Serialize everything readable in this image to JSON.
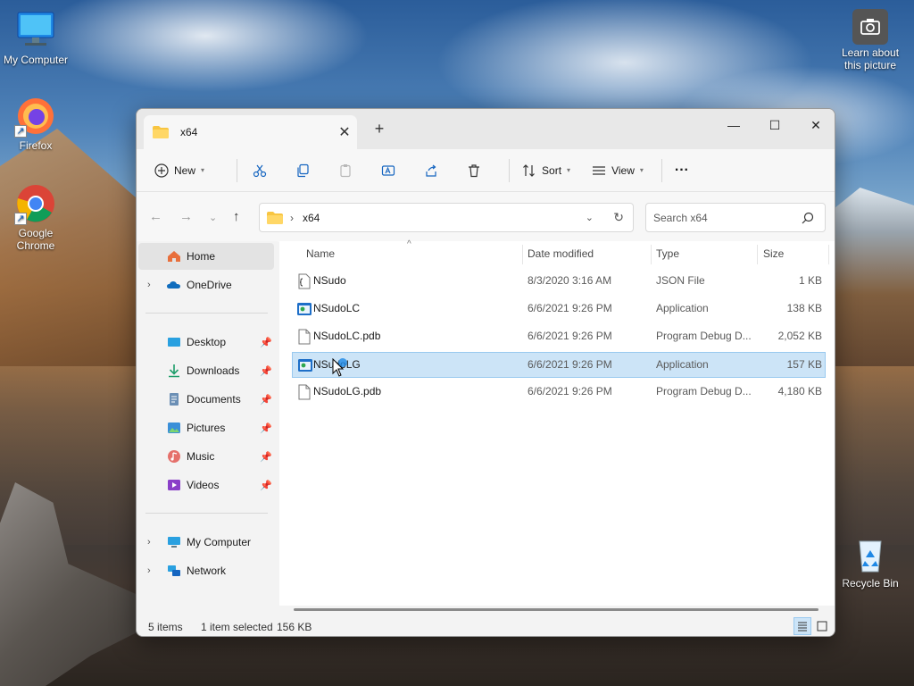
{
  "desktop": {
    "icons": [
      {
        "label": "My Computer"
      },
      {
        "label": "Firefox"
      },
      {
        "label": "Google Chrome"
      },
      {
        "label": "Learn about this picture"
      },
      {
        "label": "Recycle Bin"
      }
    ]
  },
  "window": {
    "tab_title": "x64",
    "tab_close": "✕",
    "new_tab": "+",
    "min": "—",
    "max": "☐",
    "close": "✕"
  },
  "toolbar": {
    "new_label": "New",
    "sort_label": "Sort",
    "view_label": "View",
    "more_label": "···"
  },
  "address": {
    "path_sep": "›",
    "path": "x64",
    "search_placeholder": "Search x64"
  },
  "nav": {
    "home": "Home",
    "onedrive": "OneDrive",
    "quick": [
      {
        "label": "Desktop"
      },
      {
        "label": "Downloads"
      },
      {
        "label": "Documents"
      },
      {
        "label": "Pictures"
      },
      {
        "label": "Music"
      },
      {
        "label": "Videos"
      }
    ],
    "my_computer": "My Computer",
    "network": "Network"
  },
  "columns": {
    "name": "Name",
    "date": "Date modified",
    "type": "Type",
    "size": "Size"
  },
  "files": [
    {
      "name": "NSudo",
      "date": "8/3/2020 3:16 AM",
      "type": "JSON File",
      "size": "1 KB",
      "icon": "json-icon"
    },
    {
      "name": "NSudoLC",
      "date": "6/6/2021 9:26 PM",
      "type": "Application",
      "size": "138 KB",
      "icon": "app-icon"
    },
    {
      "name": "NSudoLC.pdb",
      "date": "6/6/2021 9:26 PM",
      "type": "Program Debug D...",
      "size": "2,052 KB",
      "icon": "file-icon"
    },
    {
      "name": "NSudoLG",
      "date": "6/6/2021 9:26 PM",
      "type": "Application",
      "size": "157 KB",
      "icon": "app-icon",
      "selected": true
    },
    {
      "name": "NSudoLG.pdb",
      "date": "6/6/2021 9:26 PM",
      "type": "Program Debug D...",
      "size": "4,180 KB",
      "icon": "file-icon"
    }
  ],
  "status": {
    "items": "5 items",
    "selection": "1 item selected",
    "sel_size": "156 KB"
  }
}
